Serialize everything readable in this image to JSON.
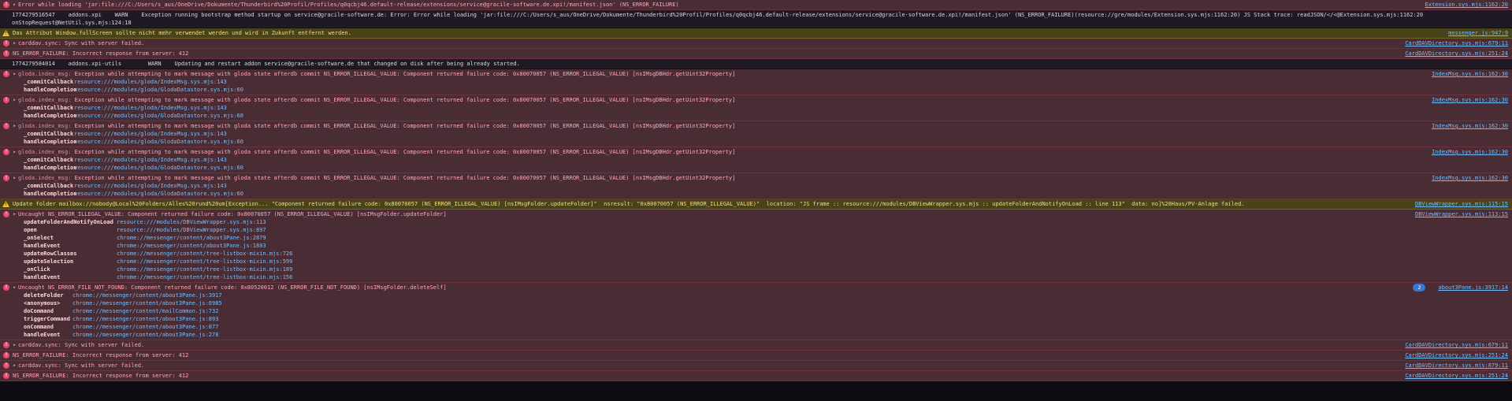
{
  "theme": {
    "error_bg": "#4a2c34",
    "warn_bg": "#494319",
    "log_bg": "#1e1923",
    "link_color": "#75bfff",
    "error_text": "#ffa7b6",
    "warn_text": "#f3dd8e",
    "badge_bg": "#3778d6"
  },
  "console": {
    "rows": [
      {
        "kind": "error",
        "message": "Error while loading 'jar:file:///C:/Users/s_aus/OneDrive/Dokumente/Thunderbird%20Profil/Profiles/q0qcbj46.default-release/extensions/service@gracile-software.de.xpi!/manifest.json' (NS_ERROR_FAILURE)",
        "source": "Extension.sys.mjs:1162:20"
      },
      {
        "kind": "log",
        "text": "1774279516547    addons.xpi    WARN    Exception running bootstrap method startup on service@gracile-software.de: Error: Error while loading 'jar:file:///C:/Users/s_aus/OneDrive/Dokumente/Thunderbird%20Profil/Profiles/q0qcbj46.default-release/extensions/service@gracile-software.de.xpi!/manifest.json' (NS_ERROR_FAILURE)(resource://gre/modules/Extension.sys.mjs:1162:20) JS Stack trace: readJSON/</<@Extension.sys.mjs:1162:20\nonStopRequest@NetUtil.sys.mjs:124:18"
      },
      {
        "kind": "warn",
        "message": "Das Attribut Window.fullScreen sollte nicht mehr verwendet werden und wird in Zukunft entfernt werden.",
        "source": "messenger.js:947:9"
      },
      {
        "kind": "error",
        "message": "carddav.sync: Sync with server failed.",
        "source": "CardDAVDirectory.sys.mjs:679:11"
      },
      {
        "kind": "error",
        "message": "NS_ERROR_FAILURE: Incorrect response from server: 412",
        "source": "CardDAVDirectory.sys.mjs:251:24"
      },
      {
        "kind": "log",
        "text": "1774279584014    addons.xpi-utils        WARN    Updating and restart addon service@gracile-software.de that changed on disk after being already started."
      },
      {
        "kind": "error",
        "prefix": "gloda.index_msg: ",
        "message": "Exception while attempting to mark message with gloda state afterdb commit NS_ERROR_ILLEGAL_VALUE: Component returned failure code: 0x80070057 (NS_ERROR_ILLEGAL_VALUE) [nsIMsgDBHdr.getUint32Property]",
        "source": "IndexMsg.sys.mjs:162:30",
        "stack": [
          {
            "fn": "_commitCallback",
            "path": "resource:///modules/gloda/IndexMsg.sys.mjs:143"
          },
          {
            "fn": "handleCompletion",
            "path": "resource:///modules/gloda/GlodaDatastore.sys.mjs:60"
          }
        ]
      },
      {
        "kind": "error",
        "prefix": "gloda.index_msg: ",
        "message": "Exception while attempting to mark message with gloda state afterdb commit NS_ERROR_ILLEGAL_VALUE: Component returned failure code: 0x80070057 (NS_ERROR_ILLEGAL_VALUE) [nsIMsgDBHdr.getUint32Property]",
        "source": "IndexMsg.sys.mjs:162:30",
        "stack": [
          {
            "fn": "_commitCallback",
            "path": "resource:///modules/gloda/IndexMsg.sys.mjs:143"
          },
          {
            "fn": "handleCompletion",
            "path": "resource:///modules/gloda/GlodaDatastore.sys.mjs:60"
          }
        ]
      },
      {
        "kind": "error",
        "prefix": "gloda.index_msg: ",
        "message": "Exception while attempting to mark message with gloda state afterdb commit NS_ERROR_ILLEGAL_VALUE: Component returned failure code: 0x80070057 (NS_ERROR_ILLEGAL_VALUE) [nsIMsgDBHdr.getUint32Property]",
        "source": "IndexMsg.sys.mjs:162:30",
        "stack": [
          {
            "fn": "_commitCallback",
            "path": "resource:///modules/gloda/IndexMsg.sys.mjs:143"
          },
          {
            "fn": "handleCompletion",
            "path": "resource:///modules/gloda/GlodaDatastore.sys.mjs:60"
          }
        ]
      },
      {
        "kind": "error",
        "prefix": "gloda.index_msg: ",
        "message": "Exception while attempting to mark message with gloda state afterdb commit NS_ERROR_ILLEGAL_VALUE: Component returned failure code: 0x80070057 (NS_ERROR_ILLEGAL_VALUE) [nsIMsgDBHdr.getUint32Property]",
        "source": "IndexMsg.sys.mjs:162:30",
        "stack": [
          {
            "fn": "_commitCallback",
            "path": "resource:///modules/gloda/IndexMsg.sys.mjs:143"
          },
          {
            "fn": "handleCompletion",
            "path": "resource:///modules/gloda/GlodaDatastore.sys.mjs:60"
          }
        ]
      },
      {
        "kind": "error",
        "prefix": "gloda.index_msg: ",
        "message": "Exception while attempting to mark message with gloda state afterdb commit NS_ERROR_ILLEGAL_VALUE: Component returned failure code: 0x80070057 (NS_ERROR_ILLEGAL_VALUE) [nsIMsgDBHdr.getUint32Property]",
        "source": "IndexMsg.sys.mjs:162:30",
        "stack": [
          {
            "fn": "_commitCallback",
            "path": "resource:///modules/gloda/IndexMsg.sys.mjs:143"
          },
          {
            "fn": "handleCompletion",
            "path": "resource:///modules/gloda/GlodaDatastore.sys.mjs:60"
          }
        ]
      },
      {
        "kind": "warn",
        "message": "Update folder mailbox://nobody@Local%20Folders/Alles%20rund%20um[Exception... \"Component returned failure code: 0x80070057 (NS_ERROR_ILLEGAL_VALUE) [nsIMsgFolder.updateFolder]\"  nsresult: \"0x80070057 (NS_ERROR_ILLEGAL_VALUE)\"  location: \"JS frame :: resource:///modules/DBViewWrapper.sys.mjs :: updateFolderAndNotifyOnLoad :: line 113\"  data: no]%20Haus/PV-Anlage failed.",
        "source": "DBViewWrapper.sys.mjs:115:15"
      },
      {
        "kind": "error",
        "message": "Uncaught NS_ERROR_ILLEGAL_VALUE: Component returned failure code: 0x80070057 (NS_ERROR_ILLEGAL_VALUE) [nsIMsgFolder.updateFolder]",
        "source": "DBViewWrapper.sys.mjs:113:15",
        "stack": [
          {
            "fn": "updateFolderAndNotifyOnLoad",
            "path": "resource:///modules/DBViewWrapper.sys.mjs:113"
          },
          {
            "fn": "open",
            "path": "resource:///modules/DBViewWrapper.sys.mjs:897"
          },
          {
            "fn": "_onSelect",
            "path": "chrome://messenger/content/about3Pane.js:2879"
          },
          {
            "fn": "handleEvent",
            "path": "chrome://messenger/content/about3Pane.js:1803"
          },
          {
            "fn": "updateRowClasses",
            "path": "chrome://messenger/content/tree-listbox-mixin.mjs:726"
          },
          {
            "fn": "updateSelection",
            "path": "chrome://messenger/content/tree-listbox-mixin.mjs:599"
          },
          {
            "fn": "_onClick",
            "path": "chrome://messenger/content/tree-listbox-mixin.mjs:189"
          },
          {
            "fn": "handleEvent",
            "path": "chrome://messenger/content/tree-listbox-mixin.mjs:156"
          }
        ]
      },
      {
        "kind": "error",
        "badge": "2",
        "message": "Uncaught NS_ERROR_FILE_NOT_FOUND: Component returned failure code: 0x80520012 (NS_ERROR_FILE_NOT_FOUND) [nsIMsgFolder.deleteSelf]",
        "source": "about3Pane.js:3917:14",
        "stack": [
          {
            "fn": "deleteFolder",
            "path": "chrome://messenger/content/about3Pane.js:3917"
          },
          {
            "fn": "<anonymous>",
            "path": "chrome://messenger/content/about3Pane.js:6985"
          },
          {
            "fn": "doCommand",
            "path": "chrome://messenger/content/mailCommon.js:732"
          },
          {
            "fn": "triggerCommand",
            "path": "chrome://messenger/content/about3Pane.js:893"
          },
          {
            "fn": "onCommand",
            "path": "chrome://messenger/content/about3Pane.js:877"
          },
          {
            "fn": "handleEvent",
            "path": "chrome://messenger/content/about3Pane.js:278"
          }
        ]
      },
      {
        "kind": "error",
        "message": "carddav.sync: Sync with server failed.",
        "source": "CardDAVDirectory.sys.mjs:679:11"
      },
      {
        "kind": "error",
        "message": "NS_ERROR_FAILURE: Incorrect response from server: 412",
        "source": "CardDAVDirectory.sys.mjs:251:24"
      },
      {
        "kind": "error",
        "message": "carddav.sync: Sync with server failed.",
        "source": "CardDAVDirectory.sys.mjs:679:11"
      },
      {
        "kind": "error",
        "message": "NS_ERROR_FAILURE: Incorrect response from server: 412",
        "source": "CardDAVDirectory.sys.mjs:251:24"
      }
    ]
  }
}
